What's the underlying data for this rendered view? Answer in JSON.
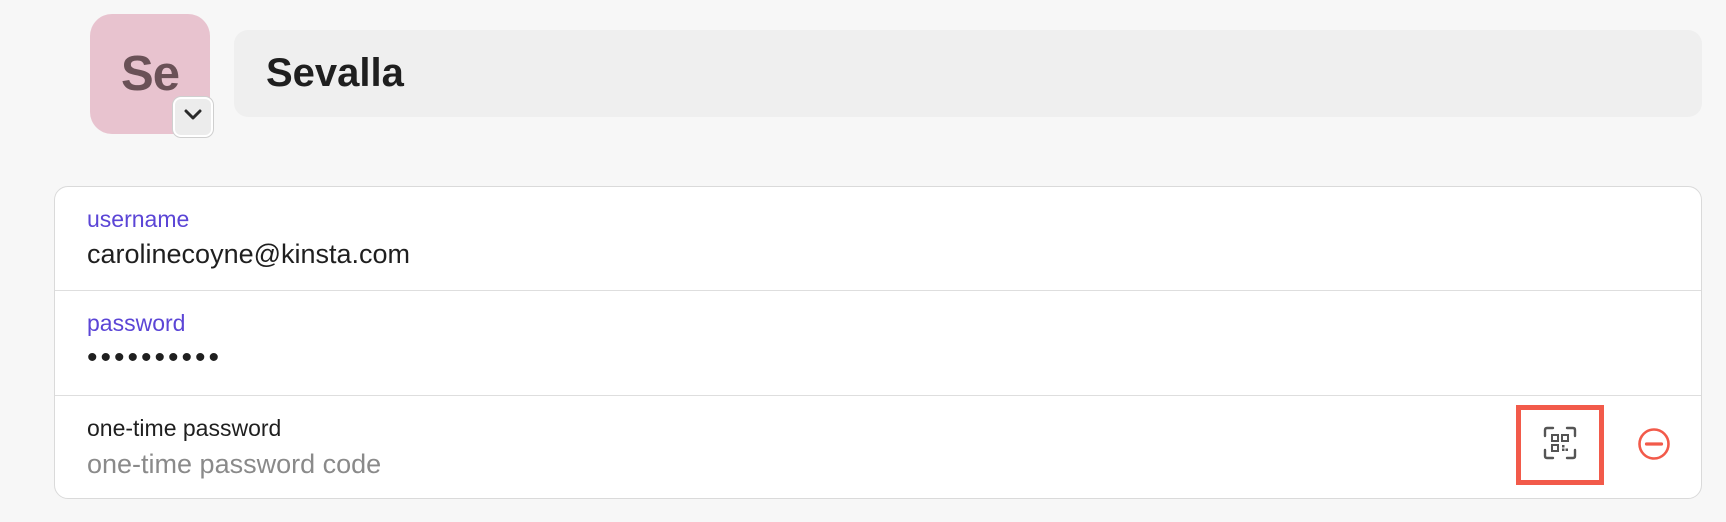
{
  "header": {
    "avatar_initials": "Se",
    "avatar_color": "#e8c3cf",
    "dropdown_icon": "chevron-down-icon",
    "title": "Sevalla"
  },
  "fields": {
    "username": {
      "label": "username",
      "value": "carolinecoyne@kinsta.com"
    },
    "password": {
      "label": "password",
      "value": "••••••••••"
    },
    "otp": {
      "label": "one-time password",
      "placeholder": "one-time password code",
      "value": "",
      "scan_icon": "qr-code-scan-icon",
      "remove_icon": "minus-circle-icon"
    }
  },
  "colors": {
    "label_accent": "#5b45d6",
    "highlight_border": "#f25a4a",
    "remove_accent": "#f25a4a"
  }
}
